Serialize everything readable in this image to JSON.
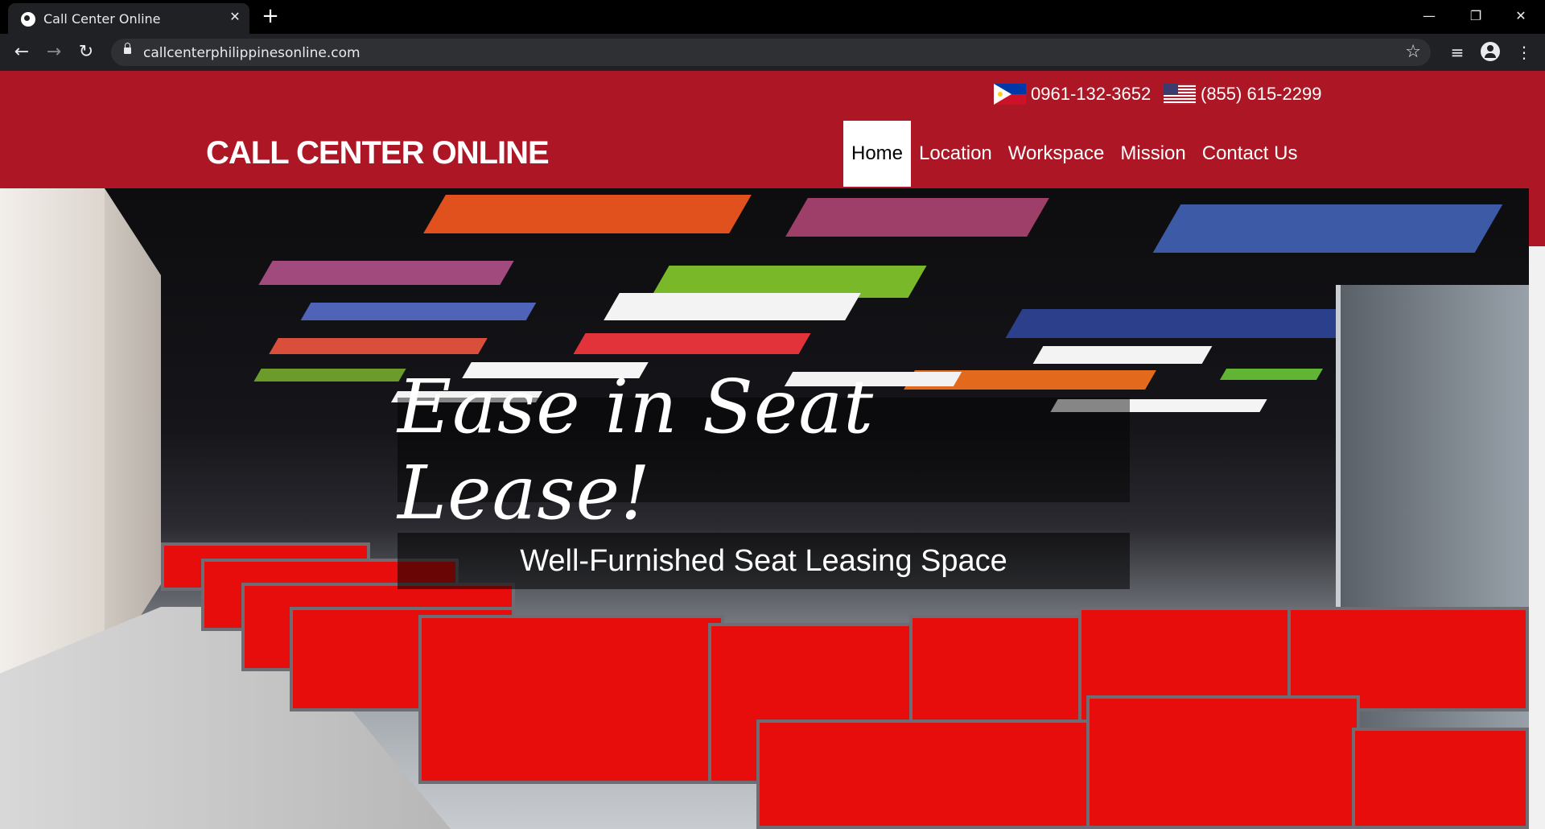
{
  "browser": {
    "tab_title": "Call Center Online",
    "url": "callcenterphilippinesonline.com",
    "new_tab_symbol": "+",
    "close_symbol": "✕",
    "minimize_symbol": "—",
    "restore_symbol": "❐",
    "window_close_symbol": "✕",
    "back_symbol": "←",
    "forward_symbol": "→",
    "reload_symbol": "↻",
    "star_symbol": "☆",
    "menu_symbol": "⋮",
    "media_symbol": "≡"
  },
  "header": {
    "phones": [
      {
        "flag": "philippines-flag-icon",
        "number": "0961-132-3652"
      },
      {
        "flag": "us-flag-icon",
        "number": "(855) 615-2299"
      }
    ],
    "logo": "CALL CENTER ONLINE",
    "nav": [
      {
        "label": "Home",
        "active": true
      },
      {
        "label": "Location",
        "active": false
      },
      {
        "label": "Workspace",
        "active": false
      },
      {
        "label": "Mission",
        "active": false
      },
      {
        "label": "Contact Us",
        "active": false
      }
    ]
  },
  "hero": {
    "title": "Ease in Seat Lease!",
    "subtitle": "Well-Furnished Seat Leasing Space"
  },
  "colors": {
    "brand_red": "#ad1624",
    "cubicle_red": "#e80d0d"
  }
}
